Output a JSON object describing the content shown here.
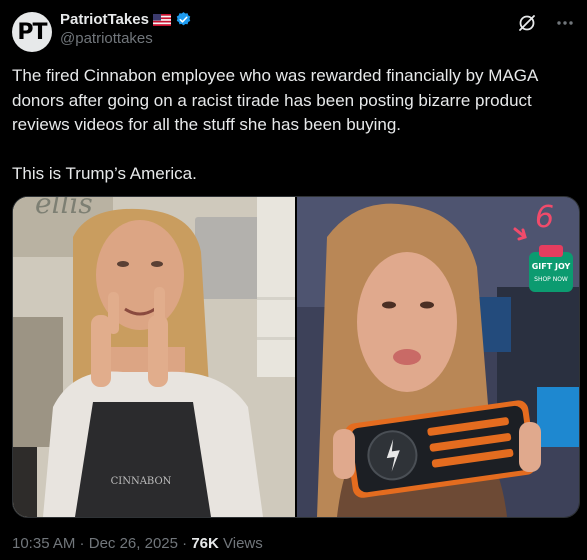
{
  "author": {
    "avatar_text": "PT",
    "display_name": "PatriotTakes",
    "handle": "@patriottakes"
  },
  "tweet": {
    "text": "The fired Cinnabon employee who was rewarded financially by MAGA donors after going on a racist tirade has been posting bizarre product reviews videos for all the stuff she has been buying.\n\nThis is Trump’s America."
  },
  "media": {
    "left": {
      "sign_text": "ellis",
      "apron_text": "CINNABON"
    },
    "right": {
      "scribble": "6",
      "sticker_line1": "GIFT JOY",
      "sticker_line2": "SHOP NOW"
    }
  },
  "meta": {
    "time": "10:35 AM",
    "sep1": " · ",
    "date": "Dec 26, 2025",
    "sep2": " · ",
    "views_count": "76K",
    "views_label": " Views"
  },
  "colors": {
    "background": "#000000",
    "text": "#e7e9ea",
    "secondary": "#71767b",
    "verified": "#1d9bf0"
  },
  "icons": [
    "grok-icon",
    "more-icon",
    "verified-badge-icon",
    "us-flag-icon"
  ]
}
